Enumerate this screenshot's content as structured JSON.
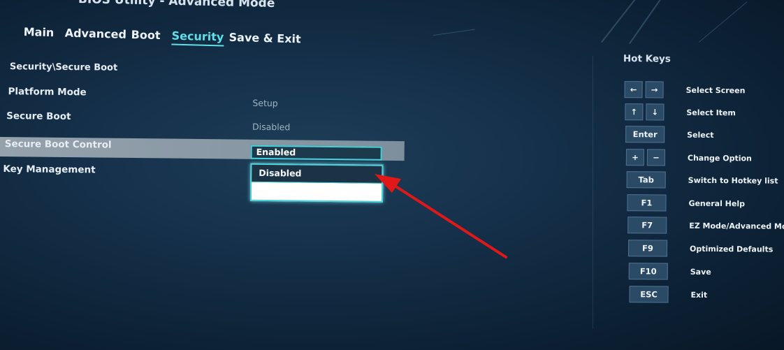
{
  "header": {
    "title": "BIOS Utility - Advanced Mode"
  },
  "tabs": [
    {
      "label": "Main"
    },
    {
      "label": "Advanced"
    },
    {
      "label": "Boot"
    },
    {
      "label": "Security"
    },
    {
      "label": "Save & Exit"
    }
  ],
  "active_tab": "Security",
  "main": {
    "breadcrumb": "Security\\Secure Boot",
    "rows": [
      {
        "label": "Platform Mode",
        "value": "Setup"
      },
      {
        "label": "Secure Boot",
        "value": "Disabled"
      },
      {
        "label": "Secure Boot Control",
        "value": "Enabled"
      },
      {
        "label": "Key Management",
        "value": ""
      }
    ],
    "dropdown_options": [
      "Disabled",
      ""
    ]
  },
  "hotkeys": {
    "title": "Hot Keys",
    "items": [
      {
        "keys": [
          "←",
          "→"
        ],
        "desc": "Select Screen"
      },
      {
        "keys": [
          "↑",
          "↓"
        ],
        "desc": "Select Item"
      },
      {
        "keys": [
          "Enter"
        ],
        "desc": "Select"
      },
      {
        "keys": [
          "+",
          "−"
        ],
        "desc": "Change Option"
      },
      {
        "keys": [
          "Tab"
        ],
        "desc": "Switch to Hotkey list"
      },
      {
        "keys": [
          "F1"
        ],
        "desc": "General Help"
      },
      {
        "keys": [
          "F7"
        ],
        "desc": "EZ Mode/Advanced Mode"
      },
      {
        "keys": [
          "F9"
        ],
        "desc": "Optimized Defaults"
      },
      {
        "keys": [
          "F10"
        ],
        "desc": "Save"
      },
      {
        "keys": [
          "ESC"
        ],
        "desc": "Exit"
      }
    ]
  },
  "colors": {
    "accent": "#46d2d8",
    "active_tab": "#5fe0e6",
    "annotation_arrow": "#e01818"
  }
}
